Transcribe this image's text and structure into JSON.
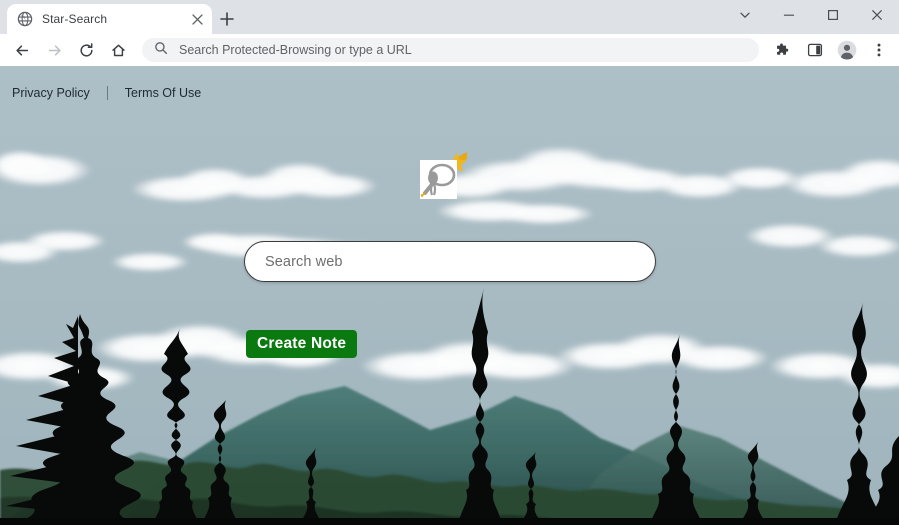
{
  "browser": {
    "tab": {
      "title": "Star-Search",
      "favicon_icon": "globe-icon",
      "close_icon": "close-icon"
    },
    "new_tab_icon": "plus-icon",
    "window_controls": [
      {
        "name": "tab-search",
        "icon": "chevron-down-icon"
      },
      {
        "name": "minimize",
        "icon": "minimize-icon"
      },
      {
        "name": "maximize",
        "icon": "maximize-icon"
      },
      {
        "name": "close",
        "icon": "close-icon"
      }
    ],
    "toolbar": {
      "back_icon": "back-arrow-icon",
      "forward_icon": "forward-arrow-icon",
      "reload_icon": "reload-icon",
      "home_icon": "home-icon",
      "omnibox": {
        "search_icon": "search-icon",
        "placeholder": "Search Protected-Browsing or type a URL",
        "value": ""
      },
      "extensions_icon": "puzzle-piece-icon",
      "side_panel_icon": "side-panel-icon",
      "profile_icon": "profile-avatar-icon",
      "menu_icon": "three-dot-menu-icon"
    }
  },
  "page": {
    "links": [
      {
        "label": "Privacy Policy"
      },
      {
        "label": "Terms Of Use"
      }
    ],
    "logo": {
      "name": "star-search-logo",
      "description": "magnifying-glass-with-shooting-star-icon"
    },
    "search": {
      "placeholder": "Search web",
      "value": ""
    },
    "create_note_label": "Create Note"
  },
  "colors": {
    "sky": "#a9bcc4",
    "button_green": "#0a7a10",
    "chrome": "#dee1e6",
    "omnibox": "#f1f3f4",
    "mountain_teal": "#3e6f6a",
    "tree_dark": "#0a0d0b",
    "logo_gold": "#e8a814",
    "logo_gray": "#9a9a9a"
  }
}
